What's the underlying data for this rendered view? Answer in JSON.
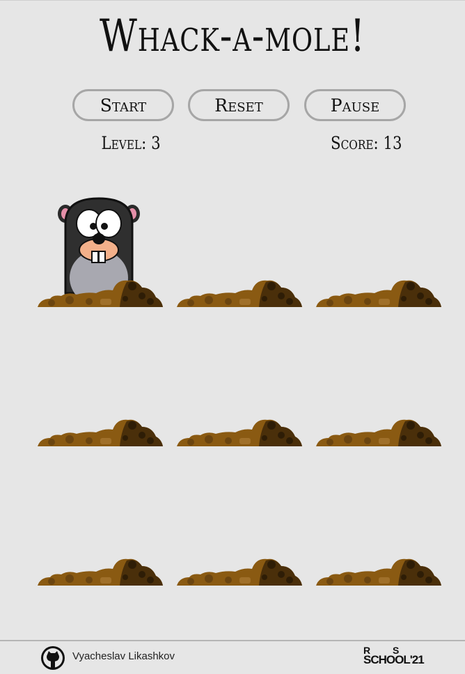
{
  "game": {
    "title": "Whack-a-mole!",
    "buttons": {
      "start": "Start",
      "reset": "Reset",
      "pause": "Pause"
    },
    "level_label": "Level: 3",
    "score_label": "Score: 13",
    "holes": [
      {
        "row": 1,
        "col": 1,
        "mole_up": true
      },
      {
        "row": 1,
        "col": 2,
        "mole_up": false
      },
      {
        "row": 1,
        "col": 3,
        "mole_up": false
      },
      {
        "row": 2,
        "col": 1,
        "mole_up": false
      },
      {
        "row": 2,
        "col": 2,
        "mole_up": false
      },
      {
        "row": 2,
        "col": 3,
        "mole_up": false
      },
      {
        "row": 3,
        "col": 1,
        "mole_up": false
      },
      {
        "row": 3,
        "col": 2,
        "mole_up": false
      },
      {
        "row": 3,
        "col": 3,
        "mole_up": false
      }
    ]
  },
  "footer": {
    "author": "Vyacheslav Likashkov",
    "github_icon": "github-icon",
    "school_logo_line1": "R S",
    "school_logo_line2": "SCHOOL'21"
  },
  "colors": {
    "background": "#e6e6e6",
    "button_border": "#a6a6a6",
    "dirt_light": "#8a5a12",
    "dirt_dark": "#4a2f0a"
  }
}
